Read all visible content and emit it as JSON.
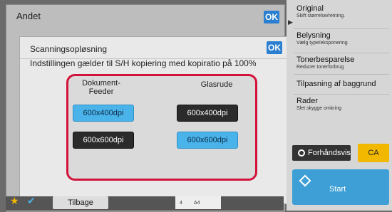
{
  "outer": {
    "title": "Andet",
    "ok_label": "OK"
  },
  "dialog": {
    "title": "Scanningsopløsning",
    "ok_label": "OK",
    "note": "Indstillingen gælder til S/H kopiering med kopiratio på 100%",
    "feeder_header": "Dokument-\nFeeder",
    "glass_header": "Glasrude",
    "feeder_options": [
      "600x400dpi",
      "600x600dpi"
    ],
    "glass_options": [
      "600x400dpi",
      "600x600dpi"
    ],
    "feeder_selected": "600x400dpi",
    "glass_selected": "600x600dpi"
  },
  "side": {
    "items": [
      {
        "title": "Original",
        "sub": "Skift størrelse/retning."
      },
      {
        "title": "Belysning",
        "sub": "Vælg type/eksponering"
      },
      {
        "title": "Tonerbesparelse",
        "sub": "Reducer tonerforbrug"
      },
      {
        "title": "Tilpasning af baggrund",
        "sub": ""
      },
      {
        "title": "Rader",
        "sub": "Slet skygge omkring"
      }
    ],
    "preview_label": "Forhåndsvis",
    "ca_label": "CA",
    "start_label": "Start"
  },
  "bottom": {
    "back_label": "Tilbage",
    "tray_rows": [
      "4",
      "A4"
    ]
  },
  "colors": {
    "accent": "#2a7fd0",
    "selected": "#49b3ea",
    "highlight": "#d3123b",
    "ca": "#f2b800"
  },
  "icons": [
    "star-icon",
    "check-icon",
    "play-icon",
    "preview-icon",
    "start-icon"
  ]
}
